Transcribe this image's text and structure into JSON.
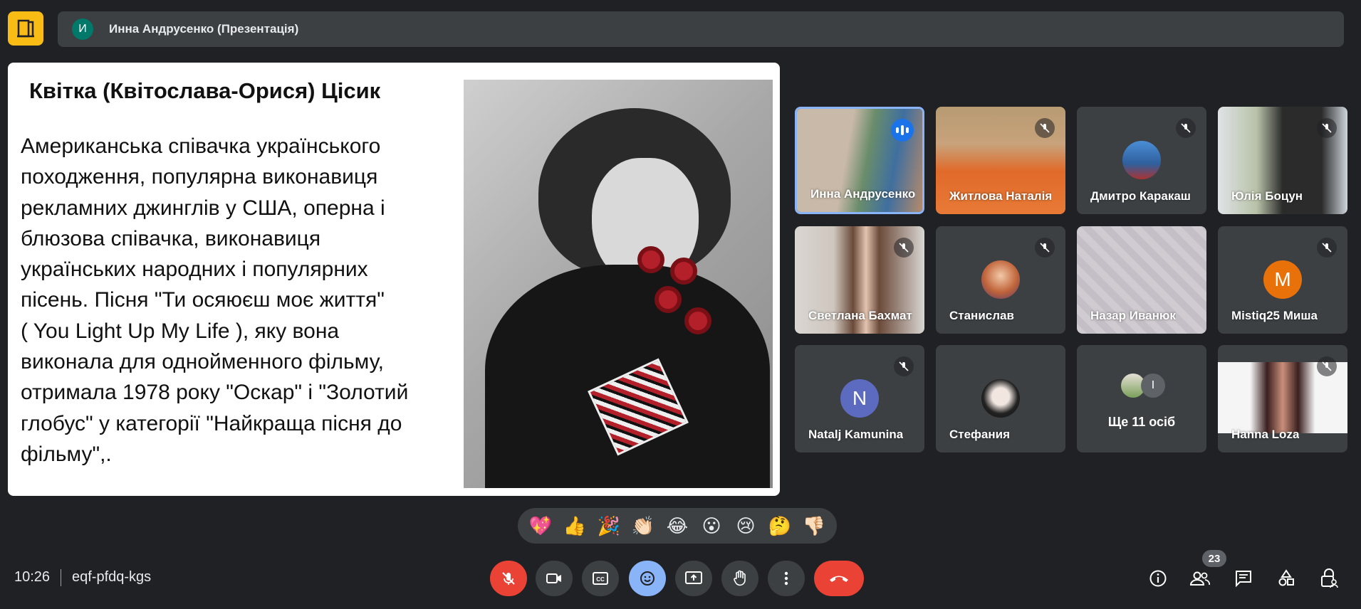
{
  "header": {
    "presenter_initial": "И",
    "presenter_title": "Инна Андрусенко (Презентація)"
  },
  "slide": {
    "title": "Квітка (Квітослава-Орися) Цісик",
    "body_lines": [
      "Американська співачка українського",
      "походження, популярна виконавиця",
      "рекламних джинглів у США, оперна і",
      "блюзова співачка, виконавиця",
      "українських народних і популярних",
      "пісень. Пісня \"Ти осяюєш моє життя\"",
      "( You Light Up My Life ), яку вона",
      "виконала для однойменного фільму,",
      "отримала 1978 року \"Оскар\" і \"Золотий",
      "глобус\" у категорії \"Найкраща пісня до",
      "фільму\",."
    ]
  },
  "participants": [
    {
      "name": "Инна Андрусенко",
      "state": "speaking"
    },
    {
      "name": "Житлова Наталія",
      "state": "muted"
    },
    {
      "name": "Дмитро Каракаш",
      "state": "muted"
    },
    {
      "name": "Юлія Боцун",
      "state": "muted"
    },
    {
      "name": "Светлана Бахмат",
      "state": "muted"
    },
    {
      "name": "Станислав",
      "state": "muted"
    },
    {
      "name": "Назар Иванюк",
      "state": "none"
    },
    {
      "name": "Mistiq25 Миша",
      "state": "muted",
      "avatar_letter": "M"
    },
    {
      "name": "Natalj Kamunina",
      "state": "muted",
      "avatar_letter": "N"
    },
    {
      "name": "Стефания",
      "state": "none"
    },
    {
      "name": "Ще 11 осіб",
      "state": "none",
      "avatar_letter": "I"
    },
    {
      "name": "Hanna Loza",
      "state": "muted"
    }
  ],
  "reactions": [
    "💖",
    "👍",
    "🎉",
    "👏🏻",
    "😂",
    "😮",
    "😢",
    "🤔",
    "👎🏻"
  ],
  "bottom_bar": {
    "time": "10:26",
    "meeting_code": "eqf-pfdq-kgs",
    "participant_count": "23"
  },
  "colors": {
    "background": "#202124",
    "tile": "#3c4043",
    "accent_blue": "#8ab4f8",
    "danger_red": "#ea4335",
    "logo_yellow": "#f9bc15"
  }
}
